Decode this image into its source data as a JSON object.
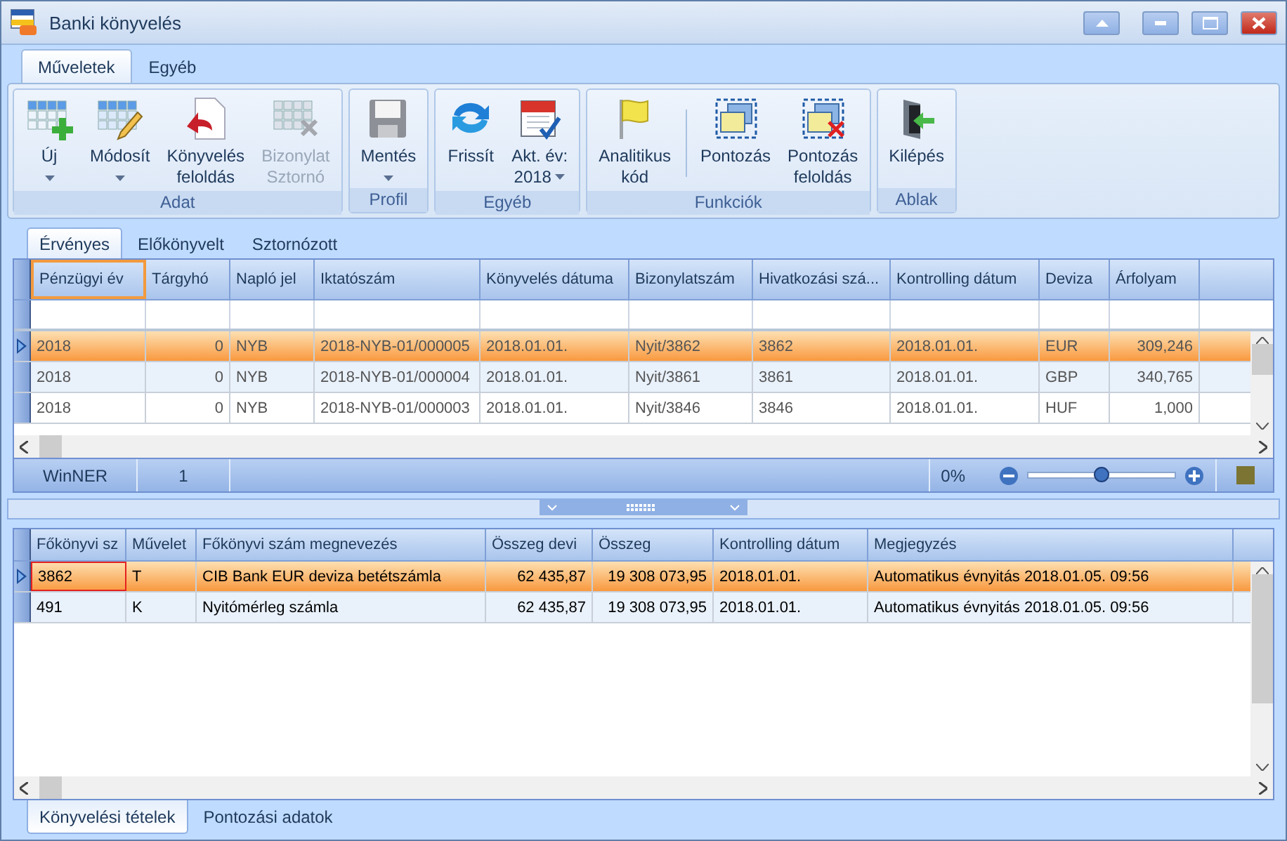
{
  "window": {
    "title": "Banki könyvelés"
  },
  "ribbon": {
    "tabs": [
      {
        "label": "Műveletek",
        "selected": true
      },
      {
        "label": "Egyéb",
        "selected": false
      }
    ],
    "groups": [
      {
        "label": "Adat",
        "buttons": [
          {
            "label": "Új",
            "dropdown": true,
            "disabled": false
          },
          {
            "label": "Módosít",
            "dropdown": true,
            "disabled": false
          },
          {
            "label": "Könyvelés\nfeloldás",
            "dropdown": false,
            "disabled": false
          },
          {
            "label": "Bizonylat\nSztornó",
            "dropdown": false,
            "disabled": true
          }
        ]
      },
      {
        "label": "Profil",
        "buttons": [
          {
            "label": "Mentés",
            "dropdown": true,
            "disabled": false
          }
        ]
      },
      {
        "label": "Egyéb",
        "buttons": [
          {
            "label": "Frissít",
            "dropdown": false,
            "disabled": false
          },
          {
            "label": "Akt. év:\n2018",
            "dropdown": true,
            "disabled": false
          }
        ]
      },
      {
        "label": "Funkciók",
        "buttons": [
          {
            "label": "Analitikus\nkód",
            "dropdown": false,
            "disabled": false
          },
          {
            "label": "Pontozás",
            "dropdown": false,
            "disabled": false,
            "divider_before": true
          },
          {
            "label": "Pontozás\nfeloldás",
            "dropdown": false,
            "disabled": false
          }
        ]
      },
      {
        "label": "Ablak",
        "buttons": [
          {
            "label": "Kilépés",
            "dropdown": false,
            "disabled": false
          }
        ]
      }
    ]
  },
  "view_tabs": [
    {
      "label": "Érvényes",
      "selected": true
    },
    {
      "label": "Előkönyvelt",
      "selected": false
    },
    {
      "label": "Sztornózott",
      "selected": false
    }
  ],
  "upper_table": {
    "columns": [
      {
        "label": "Pénzügyi év",
        "focused": true
      },
      {
        "label": "Tárgyhó",
        "focused": false
      },
      {
        "label": "Napló jel",
        "focused": false
      },
      {
        "label": "Iktatószám",
        "focused": false
      },
      {
        "label": "Könyvelés dátuma",
        "focused": false
      },
      {
        "label": "Bizonylatszám",
        "focused": false
      },
      {
        "label": "Hivatkozási szá...",
        "focused": false
      },
      {
        "label": "Kontrolling dátum",
        "focused": false
      },
      {
        "label": "Deviza",
        "focused": false
      },
      {
        "label": "Árfolyam",
        "focused": false
      }
    ],
    "rows": [
      {
        "selected": true,
        "cells": [
          "2018",
          "0",
          "NYB",
          "2018-NYB-01/000005",
          "2018.01.01.",
          "Nyit/3862",
          "3862",
          "2018.01.01.",
          "EUR",
          "309,246"
        ]
      },
      {
        "selected": false,
        "cells": [
          "2018",
          "0",
          "NYB",
          "2018-NYB-01/000004",
          "2018.01.01.",
          "Nyit/3861",
          "3861",
          "2018.01.01.",
          "GBP",
          "340,765"
        ]
      },
      {
        "selected": false,
        "cells": [
          "2018",
          "0",
          "NYB",
          "2018-NYB-01/000003",
          "2018.01.01.",
          "Nyit/3846",
          "3846",
          "2018.01.01.",
          "HUF",
          "1,000"
        ]
      }
    ]
  },
  "status_bar": {
    "source": "WinNER",
    "count": "1",
    "zoom": {
      "reading": "0%",
      "level": 0.5
    }
  },
  "lower_table": {
    "columns": [
      {
        "label": "Főkönyvi sz",
        "focused": false
      },
      {
        "label": "Művelet",
        "focused": false
      },
      {
        "label": "Főkönyvi szám megnevezés",
        "focused": false
      },
      {
        "label": "Összeg devi",
        "focused": false
      },
      {
        "label": "Összeg",
        "focused": false
      },
      {
        "label": "Kontrolling dátum",
        "focused": false
      },
      {
        "label": "Megjegyzés",
        "focused": false
      }
    ],
    "rows": [
      {
        "selected": true,
        "cells": [
          {
            "text": "3862",
            "focused": true
          },
          "T",
          "CIB Bank EUR deviza betétszámla",
          "62 435,87",
          "19 308 073,95",
          "2018.01.01.",
          "Automatikus évnyitás 2018.01.05. 09:56"
        ]
      },
      {
        "selected": false,
        "cells": [
          "491",
          "K",
          "Nyitómérleg számla",
          "62 435,87",
          "19 308 073,95",
          "2018.01.01.",
          "Automatikus évnyitás 2018.01.05. 09:56"
        ]
      }
    ]
  },
  "detail_tabs": [
    {
      "label": "Könyvelési tételek",
      "selected": true
    },
    {
      "label": "Pontozási adatok",
      "selected": false
    }
  ]
}
